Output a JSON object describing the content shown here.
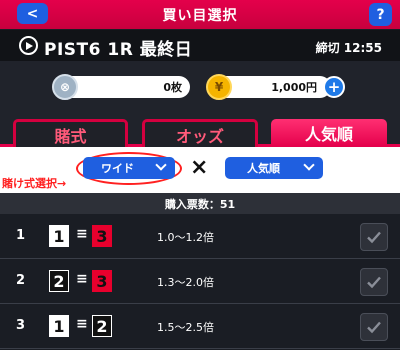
{
  "header": {
    "title": "買い目選択",
    "back_label": "<",
    "help_label": "?"
  },
  "race": {
    "title": "PIST6 1R 最終日",
    "deadline": "締切 12:55"
  },
  "balance": {
    "coupon": "0枚",
    "coupon_icon": "⊗",
    "yen": "1,000円",
    "yen_icon": "¥",
    "plus_label": "+"
  },
  "tabs": [
    {
      "label": "賭式",
      "active": false
    },
    {
      "label": "オッズ",
      "active": false
    },
    {
      "label": "人気順",
      "active": true
    }
  ],
  "selectors": {
    "bet_type": "ワイド",
    "sort": "人気順",
    "times": "×",
    "annotation": "賭け式選択→"
  },
  "count": {
    "text": "購入票数：51"
  },
  "colors": {
    "white_box": "#ffffff",
    "black_box": "#111111",
    "red_box": "#e8002d",
    "accent": "#e4004b",
    "button": "#1f5fe0"
  },
  "rows": [
    {
      "rank": "1",
      "a": "1",
      "a_color": "white",
      "eq": "≡",
      "b": "3",
      "b_color": "red",
      "odds": "1.0～1.2倍"
    },
    {
      "rank": "2",
      "a": "2",
      "a_color": "black",
      "eq": "≡",
      "b": "3",
      "b_color": "red",
      "odds": "1.3～2.0倍"
    },
    {
      "rank": "3",
      "a": "1",
      "a_color": "white",
      "eq": "≡",
      "b": "2",
      "b_color": "black",
      "odds": "1.5～2.5倍"
    }
  ]
}
